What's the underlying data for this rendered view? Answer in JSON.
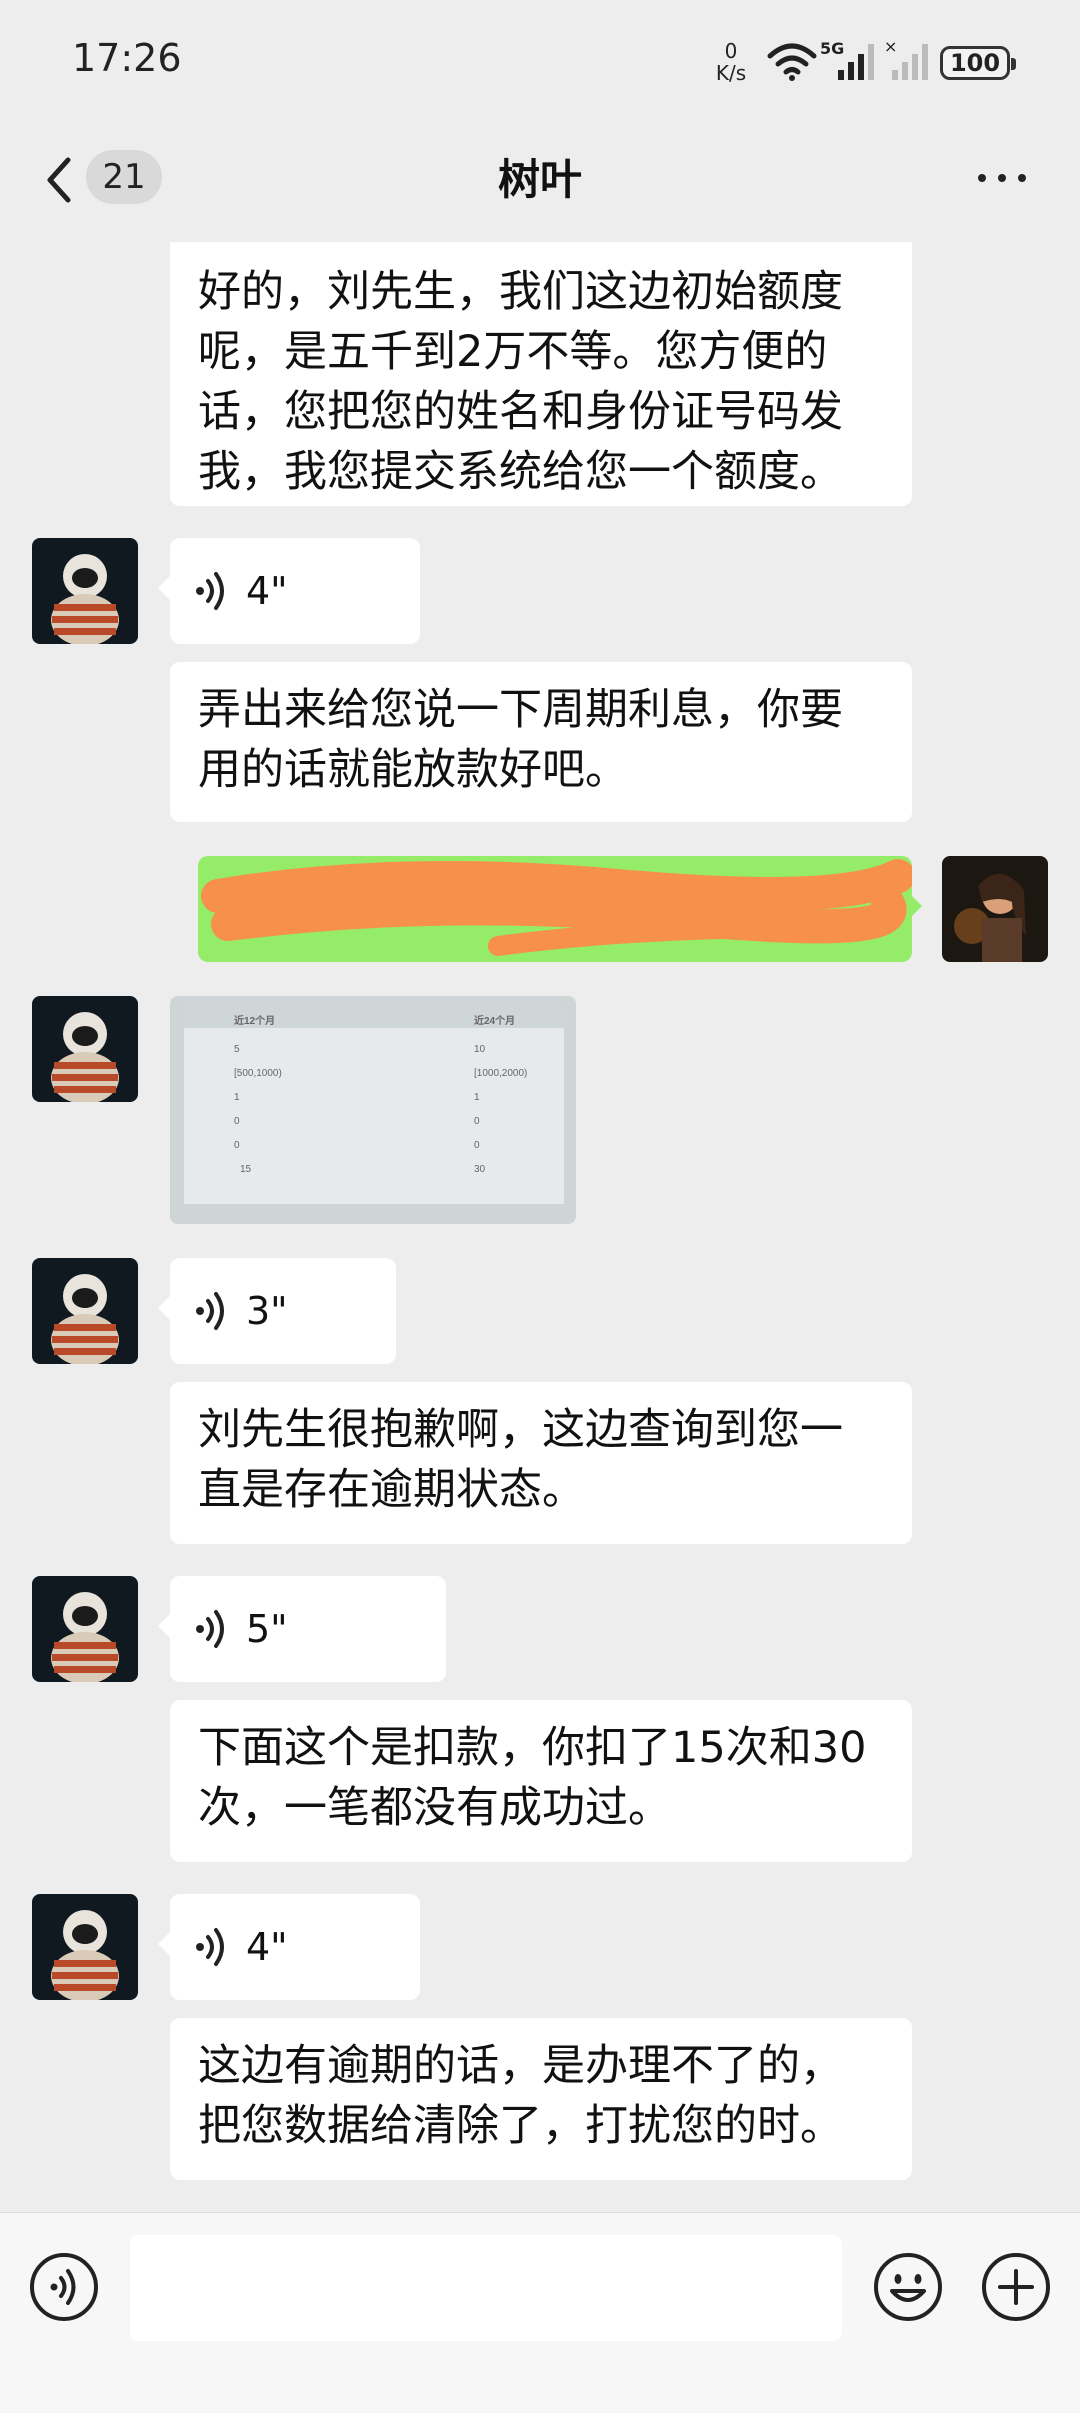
{
  "status_bar": {
    "time": "17:26",
    "net_speed_value": "0",
    "net_speed_unit": "K/s",
    "battery": "100"
  },
  "header": {
    "back_count": "21",
    "title": "树叶"
  },
  "messages": {
    "m1": "好的，刘先生，我们这边初始额度呢，是五千到2万不等。您方便的话，您把您的姓名和身份证号码发我，我您提交系统给您一个额度。",
    "v1": "4\"",
    "m2": "弄出来给您说一下周期利息，你要用的话就能放款好吧。",
    "img": {
      "col1": "近12个月",
      "col2": "近24个月",
      "rows": [
        [
          "5",
          "10"
        ],
        [
          "[500,1000)",
          "[1000,2000)"
        ],
        [
          "1",
          "1"
        ],
        [
          "0",
          "0"
        ],
        [
          "0",
          "0"
        ],
        [
          "15",
          "30"
        ]
      ]
    },
    "v2": "3\"",
    "m3": "刘先生很抱歉啊，这边查询到您一直是存在逾期状态。",
    "v3": "5\"",
    "m4": "下面这个是扣款，你扣了15次和30次，一笔都没有成功过。",
    "v4": "4\"",
    "m5": "这边有逾期的话，是办理不了的，把您数据给清除了，打扰您的时。"
  },
  "colors": {
    "outgoing_bubble": "#95ec69",
    "redaction": "#f7904a",
    "background": "#ededed"
  },
  "icons": [
    "back-chevron-icon",
    "more-icon",
    "voice-icon",
    "voice-input-icon",
    "emoji-icon",
    "add-icon"
  ]
}
